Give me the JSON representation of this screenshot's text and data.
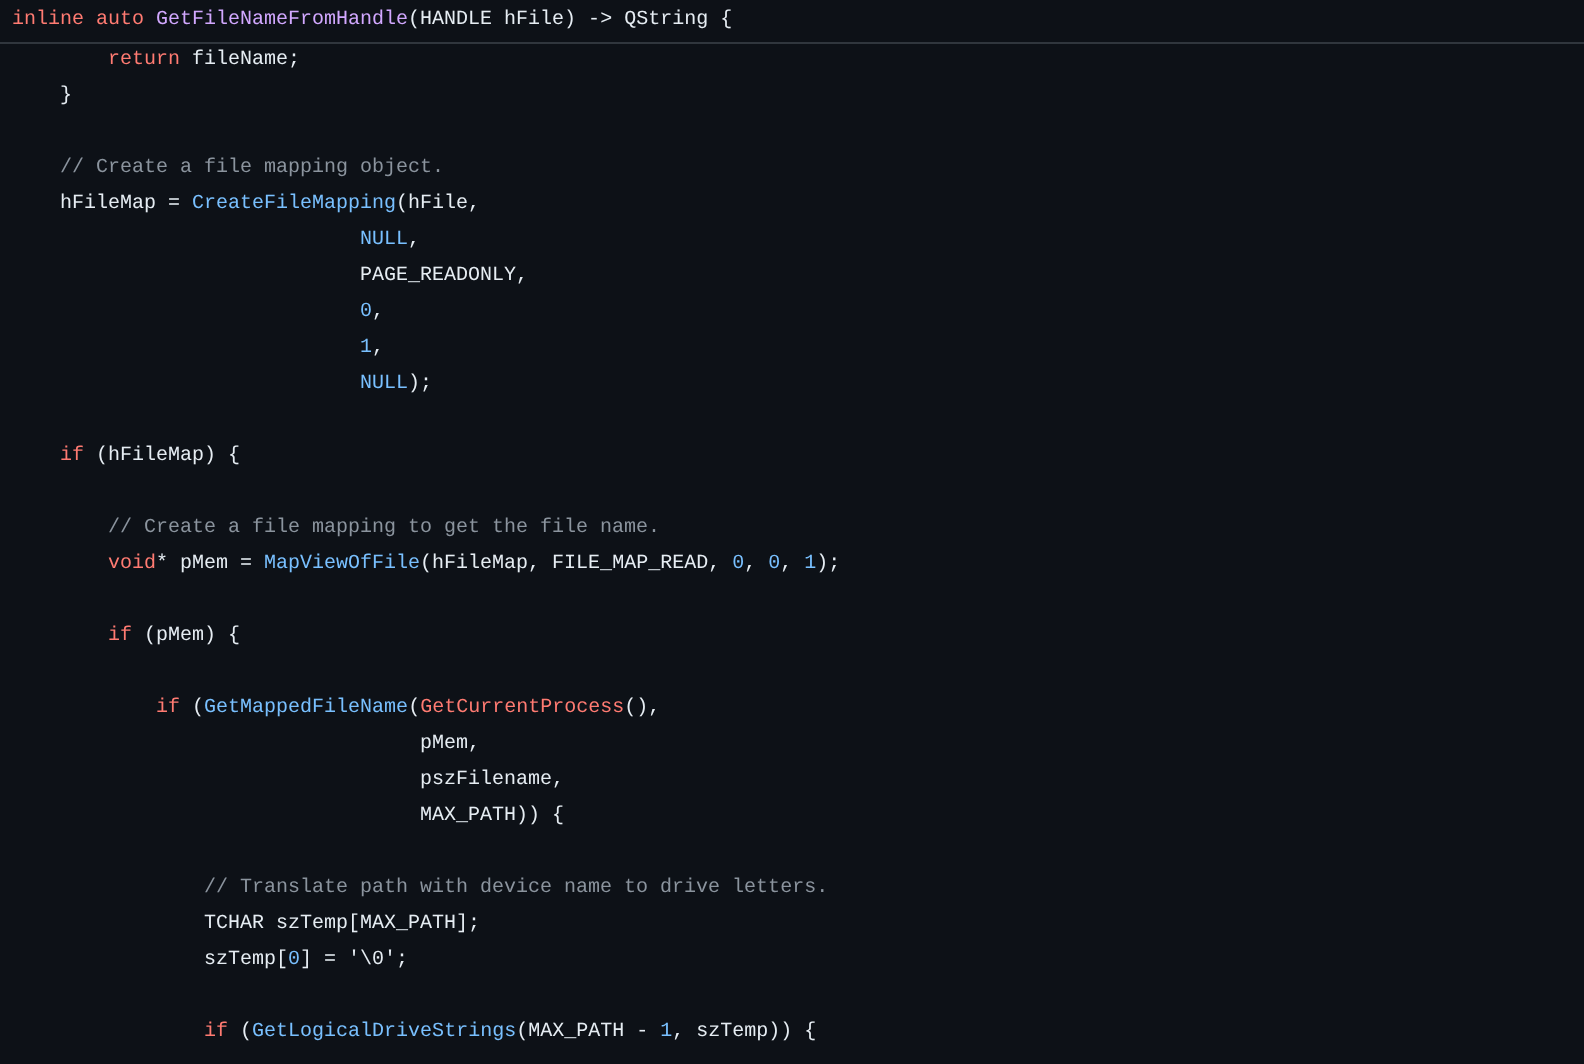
{
  "header": {
    "tokens": [
      {
        "kind": "keyword",
        "text": "inline auto "
      },
      {
        "kind": "title",
        "text": "GetFileNameFromHandle"
      },
      {
        "kind": "plain",
        "text": "(HANDLE hFile) -> QString {"
      }
    ]
  },
  "lines": [
    {
      "kind": "code",
      "tokens": [
        {
          "kind": "keyword",
          "text": "        return"
        },
        {
          "kind": "plain",
          "text": " fileName;"
        }
      ]
    },
    {
      "kind": "code",
      "tokens": [
        {
          "kind": "plain",
          "text": "    }"
        }
      ]
    },
    {
      "kind": "blank"
    },
    {
      "kind": "code",
      "tokens": [
        {
          "kind": "comment",
          "text": "    // Create a file mapping object."
        }
      ]
    },
    {
      "kind": "code",
      "tokens": [
        {
          "kind": "plain",
          "text": "    hFileMap = "
        },
        {
          "kind": "function",
          "text": "CreateFileMapping"
        },
        {
          "kind": "plain",
          "text": "(hFile,"
        }
      ]
    },
    {
      "kind": "code",
      "tokens": [
        {
          "kind": "number",
          "text": "                             NULL"
        },
        {
          "kind": "plain",
          "text": ","
        }
      ]
    },
    {
      "kind": "code",
      "tokens": [
        {
          "kind": "plain",
          "text": "                             PAGE_READONLY,"
        }
      ]
    },
    {
      "kind": "code",
      "tokens": [
        {
          "kind": "number",
          "text": "                             0"
        },
        {
          "kind": "plain",
          "text": ","
        }
      ]
    },
    {
      "kind": "code",
      "tokens": [
        {
          "kind": "number",
          "text": "                             1"
        },
        {
          "kind": "plain",
          "text": ","
        }
      ]
    },
    {
      "kind": "code",
      "tokens": [
        {
          "kind": "number",
          "text": "                             NULL"
        },
        {
          "kind": "plain",
          "text": ");"
        }
      ]
    },
    {
      "kind": "blank"
    },
    {
      "kind": "code",
      "tokens": [
        {
          "kind": "keyword",
          "text": "    if"
        },
        {
          "kind": "plain",
          "text": " (hFileMap) {"
        }
      ]
    },
    {
      "kind": "blank"
    },
    {
      "kind": "code",
      "tokens": [
        {
          "kind": "comment",
          "text": "        // Create a file mapping to get the file name."
        }
      ]
    },
    {
      "kind": "code",
      "tokens": [
        {
          "kind": "keyword",
          "text": "        void"
        },
        {
          "kind": "plain",
          "text": "* pMem = "
        },
        {
          "kind": "function",
          "text": "MapViewOfFile"
        },
        {
          "kind": "plain",
          "text": "(hFileMap, FILE_MAP_READ, "
        },
        {
          "kind": "number",
          "text": "0"
        },
        {
          "kind": "plain",
          "text": ", "
        },
        {
          "kind": "number",
          "text": "0"
        },
        {
          "kind": "plain",
          "text": ", "
        },
        {
          "kind": "number",
          "text": "1"
        },
        {
          "kind": "plain",
          "text": ");"
        }
      ]
    },
    {
      "kind": "blank"
    },
    {
      "kind": "code",
      "tokens": [
        {
          "kind": "keyword",
          "text": "        if"
        },
        {
          "kind": "plain",
          "text": " (pMem) {"
        }
      ]
    },
    {
      "kind": "blank"
    },
    {
      "kind": "code",
      "tokens": [
        {
          "kind": "keyword",
          "text": "            if"
        },
        {
          "kind": "plain",
          "text": " ("
        },
        {
          "kind": "function",
          "text": "GetMappedFileName"
        },
        {
          "kind": "plain",
          "text": "("
        },
        {
          "kind": "keyword",
          "text": "GetCurrentProcess"
        },
        {
          "kind": "plain",
          "text": "(),"
        }
      ]
    },
    {
      "kind": "code",
      "tokens": [
        {
          "kind": "plain",
          "text": "                                  pMem,"
        }
      ]
    },
    {
      "kind": "code",
      "tokens": [
        {
          "kind": "plain",
          "text": "                                  pszFilename,"
        }
      ]
    },
    {
      "kind": "code",
      "tokens": [
        {
          "kind": "plain",
          "text": "                                  MAX_PATH)) {"
        }
      ]
    },
    {
      "kind": "blank"
    },
    {
      "kind": "code",
      "tokens": [
        {
          "kind": "comment",
          "text": "                // Translate path with device name to drive letters."
        }
      ]
    },
    {
      "kind": "code",
      "tokens": [
        {
          "kind": "plain",
          "text": "                TCHAR szTemp[MAX_PATH];"
        }
      ]
    },
    {
      "kind": "code",
      "tokens": [
        {
          "kind": "plain",
          "text": "                szTemp["
        },
        {
          "kind": "number",
          "text": "0"
        },
        {
          "kind": "plain",
          "text": "] = '\\0';"
        }
      ]
    },
    {
      "kind": "blank"
    },
    {
      "kind": "code",
      "tokens": [
        {
          "kind": "keyword",
          "text": "                if"
        },
        {
          "kind": "plain",
          "text": " ("
        },
        {
          "kind": "function",
          "text": "GetLogicalDriveStrings"
        },
        {
          "kind": "plain",
          "text": "(MAX_PATH - "
        },
        {
          "kind": "number",
          "text": "1"
        },
        {
          "kind": "plain",
          "text": ", szTemp)) {"
        }
      ]
    }
  ]
}
